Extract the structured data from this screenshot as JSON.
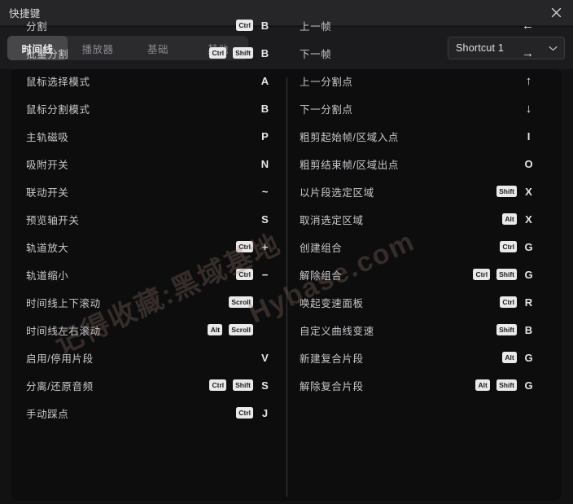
{
  "window": {
    "title": "快捷键",
    "close_icon": "close-icon"
  },
  "header": {
    "tabs": [
      {
        "label": "时间线",
        "active": true
      },
      {
        "label": "播放器",
        "active": false
      },
      {
        "label": "基础",
        "active": false
      },
      {
        "label": "其他",
        "active": false
      }
    ],
    "preset_select": {
      "value": "Shortcut 1",
      "caret_icon": "chevron-down-icon"
    }
  },
  "shortcuts": {
    "left_column": [
      {
        "label": "分割",
        "mods": [
          "Ctrl"
        ],
        "key": "B"
      },
      {
        "label": "批量分割",
        "mods": [
          "Ctrl",
          "Shift"
        ],
        "key": "B"
      },
      {
        "label": "鼠标选择模式",
        "mods": [],
        "key": "A"
      },
      {
        "label": "鼠标分割模式",
        "mods": [],
        "key": "B"
      },
      {
        "label": "主轨磁吸",
        "mods": [],
        "key": "P"
      },
      {
        "label": "吸附开关",
        "mods": [],
        "key": "N"
      },
      {
        "label": "联动开关",
        "mods": [],
        "key": "~"
      },
      {
        "label": "预览轴开关",
        "mods": [],
        "key": "S"
      },
      {
        "label": "轨道放大",
        "mods": [
          "Ctrl"
        ],
        "key": "+"
      },
      {
        "label": "轨道缩小",
        "mods": [
          "Ctrl"
        ],
        "key": "−"
      },
      {
        "label": "时间线上下滚动",
        "mods": [
          "Scroll"
        ],
        "key": ""
      },
      {
        "label": "时间线左右滚动",
        "mods": [
          "Alt",
          "Scroll"
        ],
        "key": ""
      },
      {
        "label": "启用/停用片段",
        "mods": [],
        "key": "V"
      },
      {
        "label": "分离/还原音频",
        "mods": [
          "Ctrl",
          "Shift"
        ],
        "key": "S"
      },
      {
        "label": "手动踩点",
        "mods": [
          "Ctrl"
        ],
        "key": "J"
      }
    ],
    "right_column": [
      {
        "label": "上一帧",
        "mods": [],
        "key": "←"
      },
      {
        "label": "下一帧",
        "mods": [],
        "key": "→"
      },
      {
        "label": "上一分割点",
        "mods": [],
        "key": "↑"
      },
      {
        "label": "下一分割点",
        "mods": [],
        "key": "↓"
      },
      {
        "label": "粗剪起始帧/区域入点",
        "mods": [],
        "key": "I"
      },
      {
        "label": "粗剪结束帧/区域出点",
        "mods": [],
        "key": "O"
      },
      {
        "label": "以片段选定区域",
        "mods": [
          "Shift"
        ],
        "key": "X"
      },
      {
        "label": "取消选定区域",
        "mods": [
          "Alt"
        ],
        "key": "X"
      },
      {
        "label": "创建组合",
        "mods": [
          "Ctrl"
        ],
        "key": "G"
      },
      {
        "label": "解除组合",
        "mods": [
          "Ctrl",
          "Shift"
        ],
        "key": "G"
      },
      {
        "label": "唤起变速面板",
        "mods": [
          "Ctrl"
        ],
        "key": "R"
      },
      {
        "label": "自定义曲线变速",
        "mods": [
          "Shift"
        ],
        "key": "B"
      },
      {
        "label": "新建复合片段",
        "mods": [
          "Alt"
        ],
        "key": "G"
      },
      {
        "label": "解除复合片段",
        "mods": [
          "Alt",
          "Shift"
        ],
        "key": "G"
      }
    ]
  },
  "watermark": {
    "line1": "记得收藏:黑域基地",
    "line2": "Hybase.com"
  },
  "colors": {
    "window_bg": "#121212",
    "titlebar_bg": "#262629",
    "header_bg": "#1b1b1d",
    "panel_bg": "#0d0d0d",
    "tab_group_bg": "#2b2b2e",
    "tab_active_bg": "#474749",
    "text_primary": "#e6e6e9",
    "text_secondary": "#c9c9cd",
    "text_muted": "#8a8a90",
    "badge_bg": "#e9e9ea",
    "badge_text": "#1b1b1b",
    "divider": "#3a3a3a"
  }
}
